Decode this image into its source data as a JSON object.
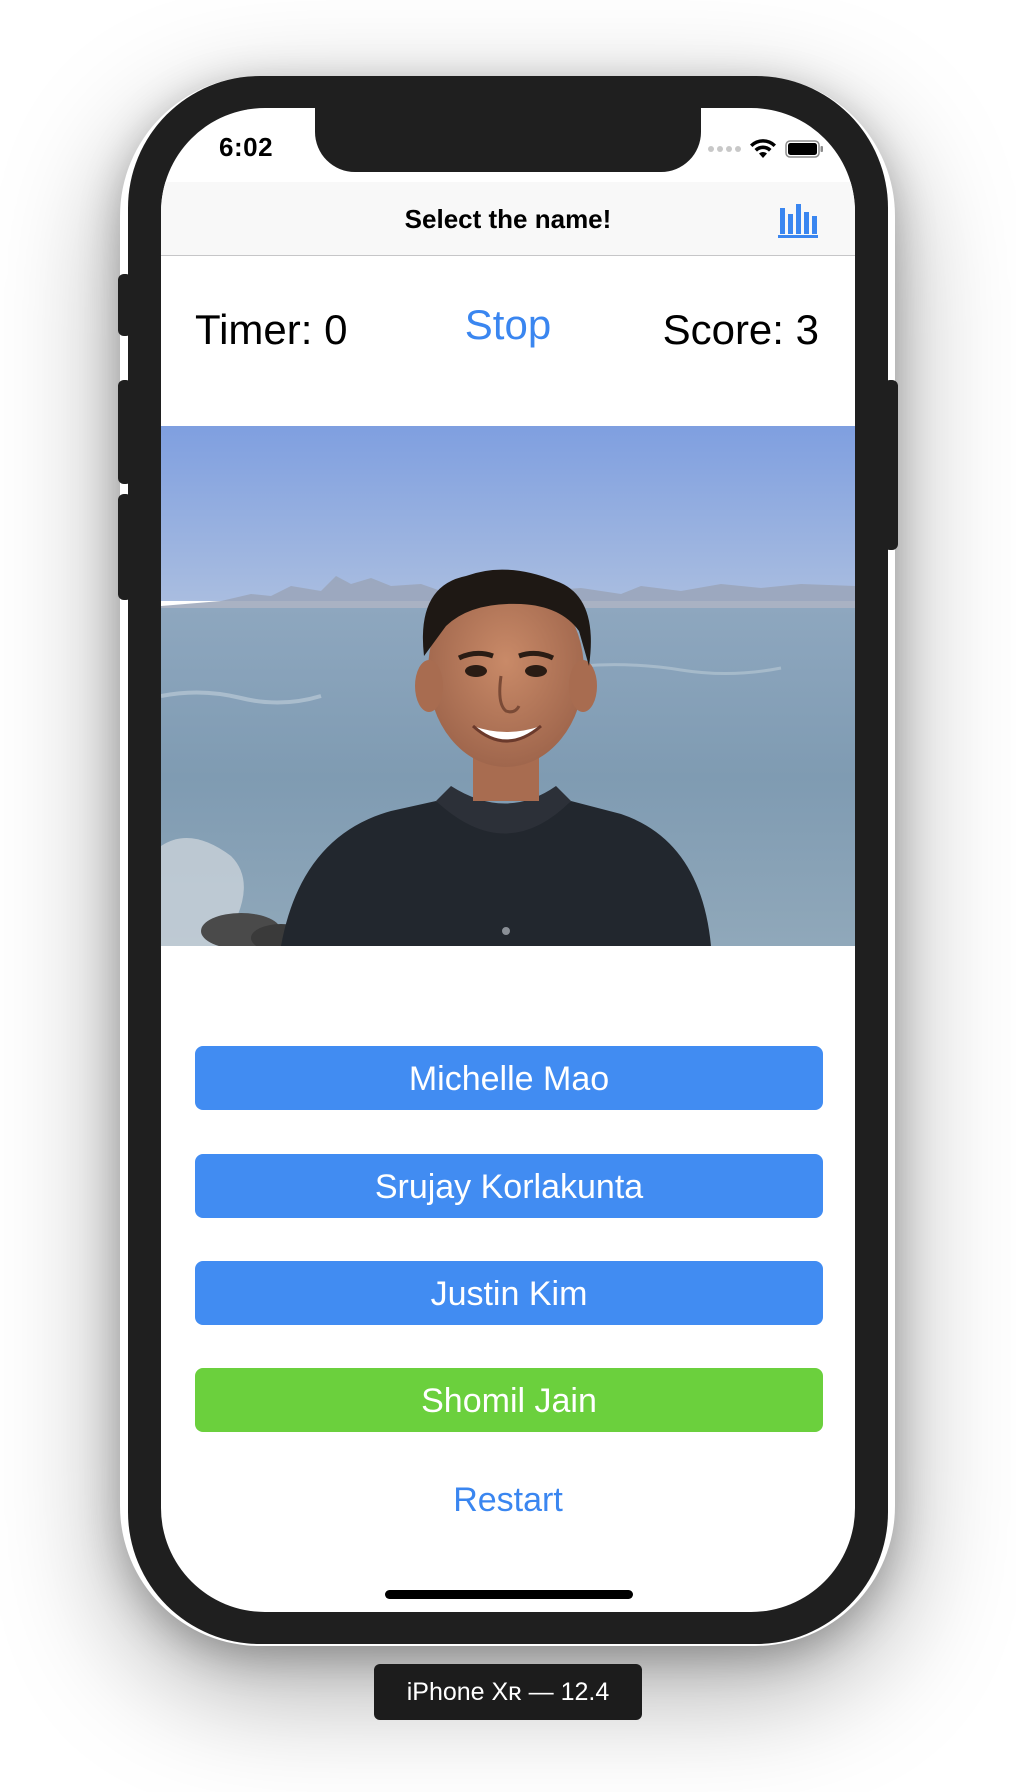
{
  "status_bar": {
    "time": "6:02",
    "icons": [
      "cellular-signal-icon",
      "wifi-icon",
      "battery-icon"
    ]
  },
  "nav": {
    "title": "Select the name!",
    "stats_icon": "bar-chart-icon"
  },
  "game": {
    "timer_label": "Timer: 0",
    "stop_label": "Stop",
    "score_label": "Score: 3"
  },
  "photo": {
    "subject": "portrait-photo"
  },
  "answers": [
    {
      "label": "Michelle Mao",
      "color": "#418cf2"
    },
    {
      "label": "Srujay Korlakunta",
      "color": "#418cf2"
    },
    {
      "label": "Justin Kim",
      "color": "#418cf2"
    },
    {
      "label": "Shomil Jain",
      "color": "#6bd03d"
    }
  ],
  "restart_label": "Restart",
  "device_label": "iPhone Xʀ — 12.4",
  "colors": {
    "accent": "#3a86f0",
    "answer_default": "#418cf2",
    "answer_correct": "#6bd03d"
  }
}
